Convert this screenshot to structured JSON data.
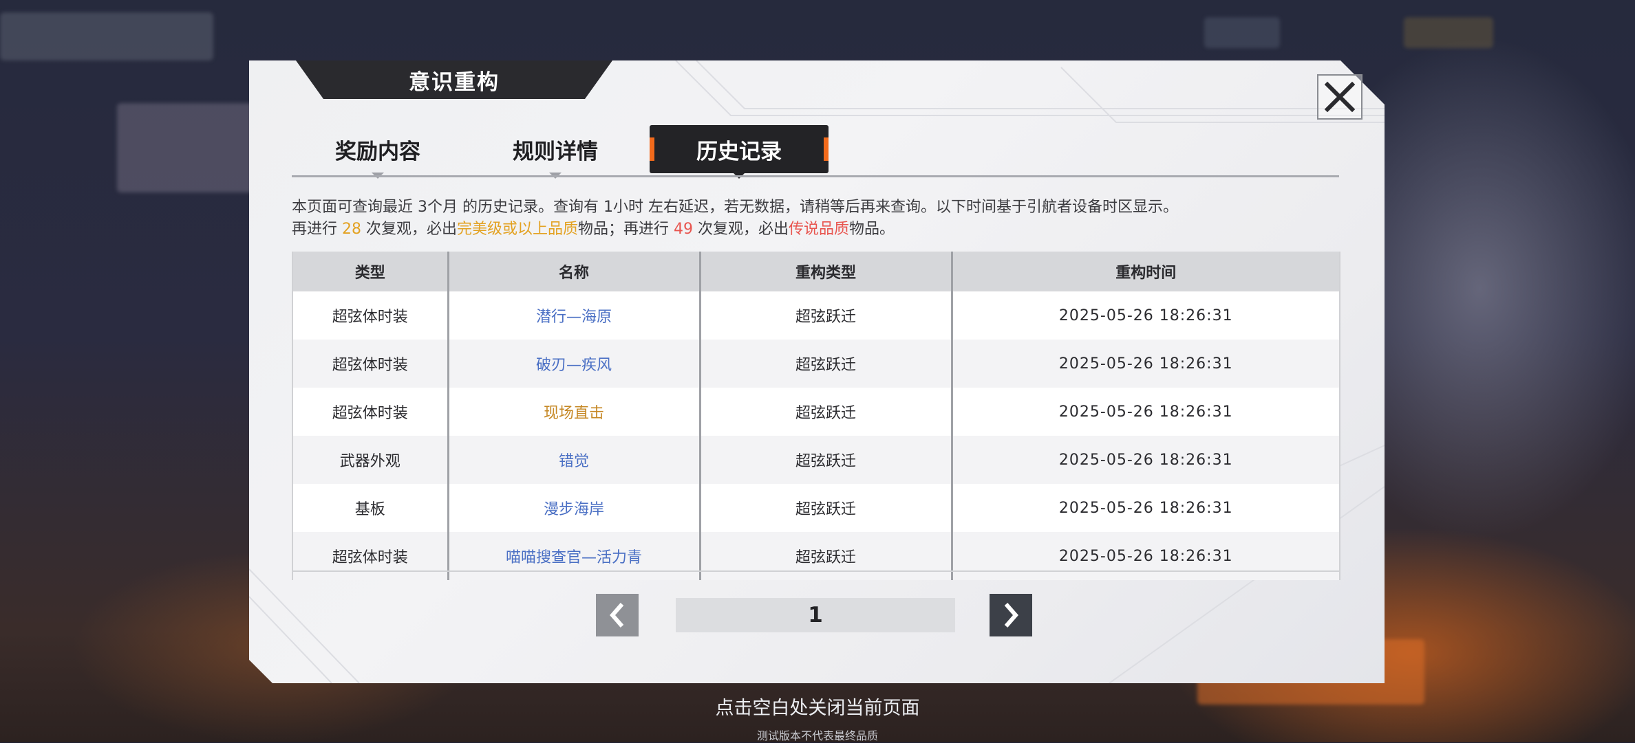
{
  "modal": {
    "title": "意识重构"
  },
  "tabs": [
    {
      "label": "奖励内容",
      "active": false
    },
    {
      "label": "规则详情",
      "active": false
    },
    {
      "label": "历史记录",
      "active": true
    }
  ],
  "info": {
    "line1": "本页面可查询最近 3个月 的历史记录。查询有 1小时 左右延迟，若无数据，请稍等后再来查询。以下时间基于引航者设备时区显示。",
    "line2_a": "再进行 ",
    "line2_count1": "28",
    "line2_b": " 次复观，必出",
    "line2_quality1": "完美级或以上品质",
    "line2_c": "物品；再进行 ",
    "line2_count2": "49",
    "line2_d": " 次复观，必出",
    "line2_quality2": "传说品质",
    "line2_e": "物品。"
  },
  "table": {
    "headers": [
      "类型",
      "名称",
      "重构类型",
      "重构时间"
    ],
    "rows": [
      {
        "type": "超弦体时装",
        "name": "潜行—海原",
        "name_color": "#4a6fc4",
        "kind": "超弦跃迁",
        "time": "2025-05-26   18:26:31"
      },
      {
        "type": "超弦体时装",
        "name": "破刃—疾风",
        "name_color": "#4a6fc4",
        "kind": "超弦跃迁",
        "time": "2025-05-26   18:26:31"
      },
      {
        "type": "超弦体时装",
        "name": "现场直击",
        "name_color": "#c68825",
        "kind": "超弦跃迁",
        "time": "2025-05-26   18:26:31"
      },
      {
        "type": "武器外观",
        "name": "错觉",
        "name_color": "#4a6fc4",
        "kind": "超弦跃迁",
        "time": "2025-05-26   18:26:31"
      },
      {
        "type": "基板",
        "name": "漫步海岸",
        "name_color": "#4a6fc4",
        "kind": "超弦跃迁",
        "time": "2025-05-26   18:26:31"
      },
      {
        "type": "超弦体时装",
        "name": "喵喵搜查官—活力青",
        "name_color": "#4a6fc4",
        "kind": "超弦跃迁",
        "time": "2025-05-26   18:26:31"
      }
    ]
  },
  "pager": {
    "page": "1",
    "prev_icon": "chevron-left-icon",
    "next_icon": "chevron-right-icon"
  },
  "hint": {
    "main": "点击空白处关闭当前页面",
    "sub": "测试版本不代表最终品质"
  },
  "colors": {
    "accent_orange": "#f26a1b",
    "gold": "#e3a222",
    "red": "#e8554f",
    "blue": "#4a6fc4"
  }
}
